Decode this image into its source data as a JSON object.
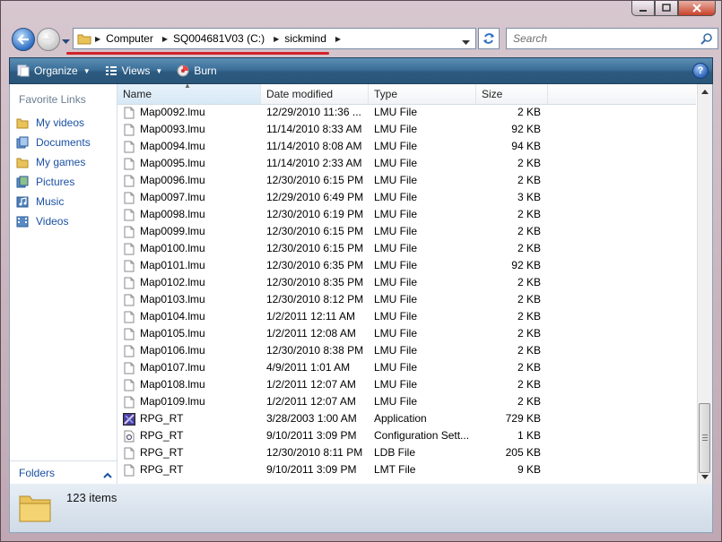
{
  "window": {
    "controls": {
      "minimize": "minimize",
      "maximize": "maximize",
      "close": "close"
    }
  },
  "address": {
    "segments": [
      "Computer",
      "SQ004681V03 (C:)",
      "sickmind"
    ]
  },
  "search": {
    "placeholder": "Search"
  },
  "toolbar": {
    "organize": "Organize",
    "views": "Views",
    "burn": "Burn",
    "help": "?"
  },
  "nav": {
    "title": "Favorite Links",
    "links": [
      "My videos",
      "Documents",
      "My games",
      "Pictures",
      "Music",
      "Videos"
    ],
    "folders": "Folders"
  },
  "columns": {
    "name": "Name",
    "date": "Date modified",
    "type": "Type",
    "size": "Size"
  },
  "files": [
    {
      "name": "Map0092.lmu",
      "date": "12/29/2010 11:36 ...",
      "type": "LMU File",
      "size": "2 KB",
      "icon": "file-icon"
    },
    {
      "name": "Map0093.lmu",
      "date": "11/14/2010 8:33 AM",
      "type": "LMU File",
      "size": "92 KB",
      "icon": "file-icon"
    },
    {
      "name": "Map0094.lmu",
      "date": "11/14/2010 8:08 AM",
      "type": "LMU File",
      "size": "94 KB",
      "icon": "file-icon"
    },
    {
      "name": "Map0095.lmu",
      "date": "11/14/2010 2:33 AM",
      "type": "LMU File",
      "size": "2 KB",
      "icon": "file-icon"
    },
    {
      "name": "Map0096.lmu",
      "date": "12/30/2010 6:15 PM",
      "type": "LMU File",
      "size": "2 KB",
      "icon": "file-icon"
    },
    {
      "name": "Map0097.lmu",
      "date": "12/29/2010 6:49 PM",
      "type": "LMU File",
      "size": "3 KB",
      "icon": "file-icon"
    },
    {
      "name": "Map0098.lmu",
      "date": "12/30/2010 6:19 PM",
      "type": "LMU File",
      "size": "2 KB",
      "icon": "file-icon"
    },
    {
      "name": "Map0099.lmu",
      "date": "12/30/2010 6:15 PM",
      "type": "LMU File",
      "size": "2 KB",
      "icon": "file-icon"
    },
    {
      "name": "Map0100.lmu",
      "date": "12/30/2010 6:15 PM",
      "type": "LMU File",
      "size": "2 KB",
      "icon": "file-icon"
    },
    {
      "name": "Map0101.lmu",
      "date": "12/30/2010 6:35 PM",
      "type": "LMU File",
      "size": "92 KB",
      "icon": "file-icon"
    },
    {
      "name": "Map0102.lmu",
      "date": "12/30/2010 8:35 PM",
      "type": "LMU File",
      "size": "2 KB",
      "icon": "file-icon"
    },
    {
      "name": "Map0103.lmu",
      "date": "12/30/2010 8:12 PM",
      "type": "LMU File",
      "size": "2 KB",
      "icon": "file-icon"
    },
    {
      "name": "Map0104.lmu",
      "date": "1/2/2011 12:11 AM",
      "type": "LMU File",
      "size": "2 KB",
      "icon": "file-icon"
    },
    {
      "name": "Map0105.lmu",
      "date": "1/2/2011 12:08 AM",
      "type": "LMU File",
      "size": "2 KB",
      "icon": "file-icon"
    },
    {
      "name": "Map0106.lmu",
      "date": "12/30/2010 8:38 PM",
      "type": "LMU File",
      "size": "2 KB",
      "icon": "file-icon"
    },
    {
      "name": "Map0107.lmu",
      "date": "4/9/2011 1:01 AM",
      "type": "LMU File",
      "size": "2 KB",
      "icon": "file-icon"
    },
    {
      "name": "Map0108.lmu",
      "date": "1/2/2011 12:07 AM",
      "type": "LMU File",
      "size": "2 KB",
      "icon": "file-icon"
    },
    {
      "name": "Map0109.lmu",
      "date": "1/2/2011 12:07 AM",
      "type": "LMU File",
      "size": "2 KB",
      "icon": "file-icon"
    },
    {
      "name": "RPG_RT",
      "date": "3/28/2003 1:00 AM",
      "type": "Application",
      "size": "729 KB",
      "icon": "application-icon"
    },
    {
      "name": "RPG_RT",
      "date": "9/10/2011 3:09 PM",
      "type": "Configuration Sett...",
      "size": "1 KB",
      "icon": "config-file-icon"
    },
    {
      "name": "RPG_RT",
      "date": "12/30/2010 8:11 PM",
      "type": "LDB File",
      "size": "205 KB",
      "icon": "file-icon"
    },
    {
      "name": "RPG_RT",
      "date": "9/10/2011 3:09 PM",
      "type": "LMT File",
      "size": "9 KB",
      "icon": "file-icon"
    }
  ],
  "details": {
    "count": "123 items"
  },
  "colors": {
    "accent": "#3c6f98",
    "link": "#1a50a3",
    "underline": "#d2232a"
  }
}
